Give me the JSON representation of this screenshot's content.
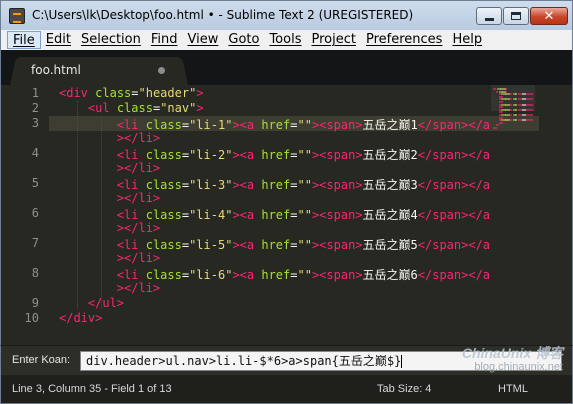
{
  "window": {
    "title": "C:\\Users\\lk\\Desktop\\foo.html • - Sublime Text 2 (UREGISTERED)",
    "close_glyph": "✕"
  },
  "menu": {
    "items": [
      {
        "label": "File"
      },
      {
        "label": "Edit"
      },
      {
        "label": "Selection"
      },
      {
        "label": "Find"
      },
      {
        "label": "View"
      },
      {
        "label": "Goto"
      },
      {
        "label": "Tools"
      },
      {
        "label": "Project"
      },
      {
        "label": "Preferences"
      },
      {
        "label": "Help"
      }
    ]
  },
  "tabs": [
    {
      "label": "foo.html",
      "dirty": true
    }
  ],
  "editor": {
    "current_line": 3,
    "lines": [
      {
        "n": "1",
        "tokens": [
          [
            "t",
            "<div"
          ],
          [
            "p",
            " "
          ],
          [
            "a",
            "class"
          ],
          [
            "p",
            "="
          ],
          [
            "s",
            "\"header\""
          ],
          [
            "t",
            ">"
          ]
        ]
      },
      {
        "n": "2",
        "tokens": [
          [
            "p",
            "    "
          ],
          [
            "t",
            "<ul"
          ],
          [
            "p",
            " "
          ],
          [
            "a",
            "class"
          ],
          [
            "p",
            "="
          ],
          [
            "s",
            "\"nav\""
          ],
          [
            "t",
            ">"
          ]
        ]
      },
      {
        "n": "3",
        "tokens": [
          [
            "p",
            "        "
          ],
          [
            "t",
            "<li"
          ],
          [
            "p",
            " "
          ],
          [
            "a",
            "class"
          ],
          [
            "p",
            "="
          ],
          [
            "s",
            "\"li-1\""
          ],
          [
            "t",
            "><a"
          ],
          [
            "p",
            " "
          ],
          [
            "a",
            "href"
          ],
          [
            "p",
            "="
          ],
          [
            "s",
            "\"\""
          ],
          [
            "t",
            "><span>"
          ],
          [
            "p",
            "五岳之巅1"
          ],
          [
            "t",
            "</span></a"
          ]
        ]
      },
      {
        "n": "",
        "tokens": [
          [
            "p",
            "        "
          ],
          [
            "t",
            "></li>"
          ]
        ]
      },
      {
        "n": "4",
        "tokens": [
          [
            "p",
            "        "
          ],
          [
            "t",
            "<li"
          ],
          [
            "p",
            " "
          ],
          [
            "a",
            "class"
          ],
          [
            "p",
            "="
          ],
          [
            "s",
            "\"li-2\""
          ],
          [
            "t",
            "><a"
          ],
          [
            "p",
            " "
          ],
          [
            "a",
            "href"
          ],
          [
            "p",
            "="
          ],
          [
            "s",
            "\"\""
          ],
          [
            "t",
            "><span>"
          ],
          [
            "p",
            "五岳之巅2"
          ],
          [
            "t",
            "</span></a"
          ]
        ]
      },
      {
        "n": "",
        "tokens": [
          [
            "p",
            "        "
          ],
          [
            "t",
            "></li>"
          ]
        ]
      },
      {
        "n": "5",
        "tokens": [
          [
            "p",
            "        "
          ],
          [
            "t",
            "<li"
          ],
          [
            "p",
            " "
          ],
          [
            "a",
            "class"
          ],
          [
            "p",
            "="
          ],
          [
            "s",
            "\"li-3\""
          ],
          [
            "t",
            "><a"
          ],
          [
            "p",
            " "
          ],
          [
            "a",
            "href"
          ],
          [
            "p",
            "="
          ],
          [
            "s",
            "\"\""
          ],
          [
            "t",
            "><span>"
          ],
          [
            "p",
            "五岳之巅3"
          ],
          [
            "t",
            "</span></a"
          ]
        ]
      },
      {
        "n": "",
        "tokens": [
          [
            "p",
            "        "
          ],
          [
            "t",
            "></li>"
          ]
        ]
      },
      {
        "n": "6",
        "tokens": [
          [
            "p",
            "        "
          ],
          [
            "t",
            "<li"
          ],
          [
            "p",
            " "
          ],
          [
            "a",
            "class"
          ],
          [
            "p",
            "="
          ],
          [
            "s",
            "\"li-4\""
          ],
          [
            "t",
            "><a"
          ],
          [
            "p",
            " "
          ],
          [
            "a",
            "href"
          ],
          [
            "p",
            "="
          ],
          [
            "s",
            "\"\""
          ],
          [
            "t",
            "><span>"
          ],
          [
            "p",
            "五岳之巅4"
          ],
          [
            "t",
            "</span></a"
          ]
        ]
      },
      {
        "n": "",
        "tokens": [
          [
            "p",
            "        "
          ],
          [
            "t",
            "></li>"
          ]
        ]
      },
      {
        "n": "7",
        "tokens": [
          [
            "p",
            "        "
          ],
          [
            "t",
            "<li"
          ],
          [
            "p",
            " "
          ],
          [
            "a",
            "class"
          ],
          [
            "p",
            "="
          ],
          [
            "s",
            "\"li-5\""
          ],
          [
            "t",
            "><a"
          ],
          [
            "p",
            " "
          ],
          [
            "a",
            "href"
          ],
          [
            "p",
            "="
          ],
          [
            "s",
            "\"\""
          ],
          [
            "t",
            "><span>"
          ],
          [
            "p",
            "五岳之巅5"
          ],
          [
            "t",
            "</span></a"
          ]
        ]
      },
      {
        "n": "",
        "tokens": [
          [
            "p",
            "        "
          ],
          [
            "t",
            "></li>"
          ]
        ]
      },
      {
        "n": "8",
        "tokens": [
          [
            "p",
            "        "
          ],
          [
            "t",
            "<li"
          ],
          [
            "p",
            " "
          ],
          [
            "a",
            "class"
          ],
          [
            "p",
            "="
          ],
          [
            "s",
            "\"li-6\""
          ],
          [
            "t",
            "><a"
          ],
          [
            "p",
            " "
          ],
          [
            "a",
            "href"
          ],
          [
            "p",
            "="
          ],
          [
            "s",
            "\"\""
          ],
          [
            "t",
            "><span>"
          ],
          [
            "p",
            "五岳之巅6"
          ],
          [
            "t",
            "</span></a"
          ]
        ]
      },
      {
        "n": "",
        "tokens": [
          [
            "p",
            "        "
          ],
          [
            "t",
            "></li>"
          ]
        ]
      },
      {
        "n": "9",
        "tokens": [
          [
            "p",
            "    "
          ],
          [
            "t",
            "</ul>"
          ]
        ]
      },
      {
        "n": "10",
        "tokens": [
          [
            "t",
            "</div>"
          ]
        ]
      }
    ]
  },
  "koan": {
    "label": "Enter Koan:",
    "value": "div.header>ul.nav>li.li-$*6>a>span{五岳之巅$}"
  },
  "watermark": {
    "text": "ChinaUnix 博客",
    "url": "blog.chinaunix.net"
  },
  "status": {
    "position": "Line 3, Column 35 - Field 1 of 13",
    "tab_size": "Tab Size: 4",
    "syntax": "HTML"
  },
  "colors": {
    "tag": "#f92672",
    "attribute": "#a6e22e",
    "string": "#e6db74",
    "text": "#f8f8f2",
    "background": "#272822"
  }
}
